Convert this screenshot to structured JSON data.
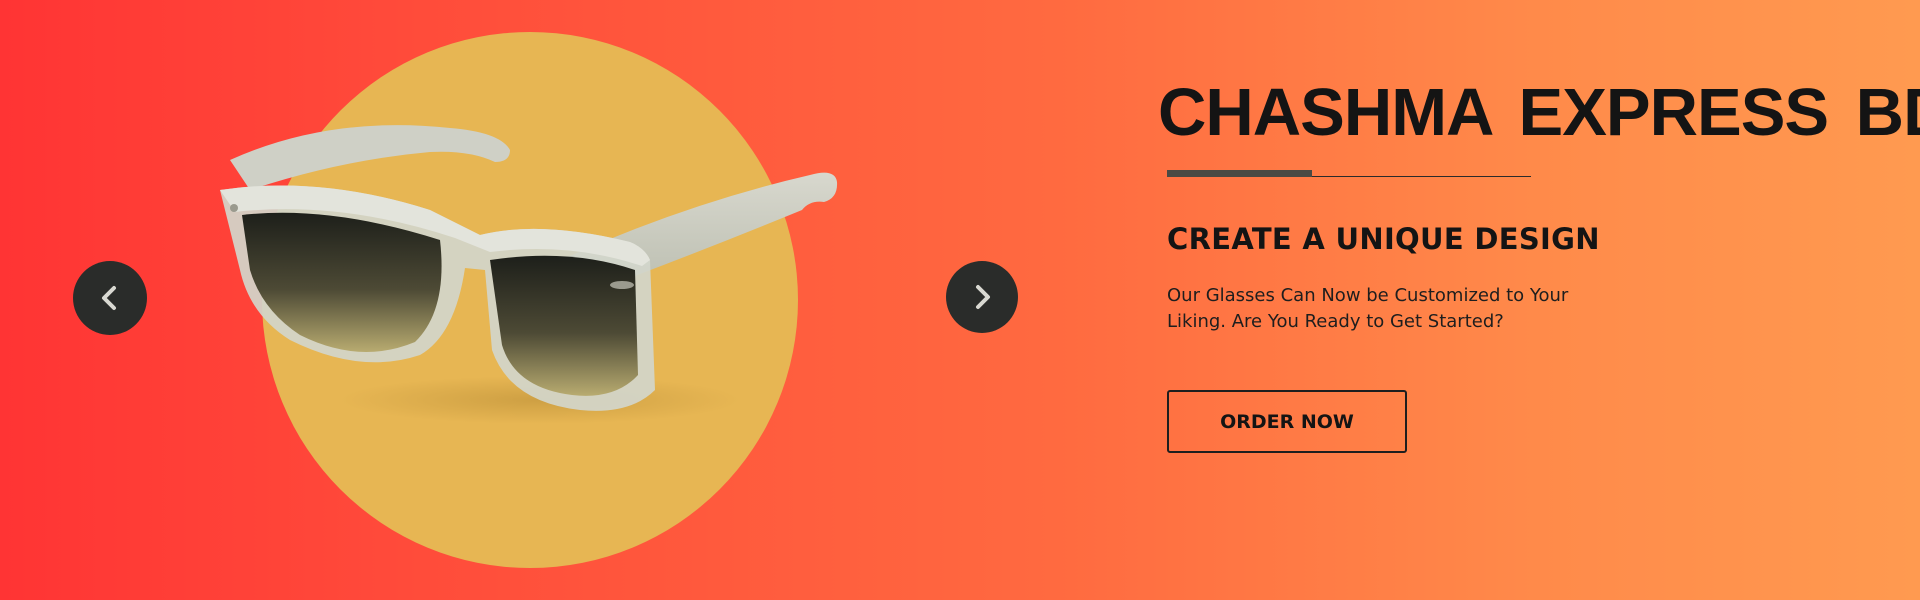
{
  "hero": {
    "brand_title": "CHASHMA EXPRESS BD",
    "headline": "CREATE A UNIQUE DESIGN",
    "tagline": "Our Glasses Can Now be Customized to Your Liking. Are You Ready to Get Started?",
    "cta_label": "ORDER NOW",
    "product_image": "sunglasses-product-image"
  },
  "carousel": {
    "prev_icon": "chevron-left-icon",
    "next_icon": "chevron-right-icon"
  },
  "colors": {
    "gradient_start": "#ff3434",
    "gradient_end": "#ff9a50",
    "circle": "#e7b653",
    "arrow_bg": "#2a2c2a",
    "text": "#141414"
  }
}
